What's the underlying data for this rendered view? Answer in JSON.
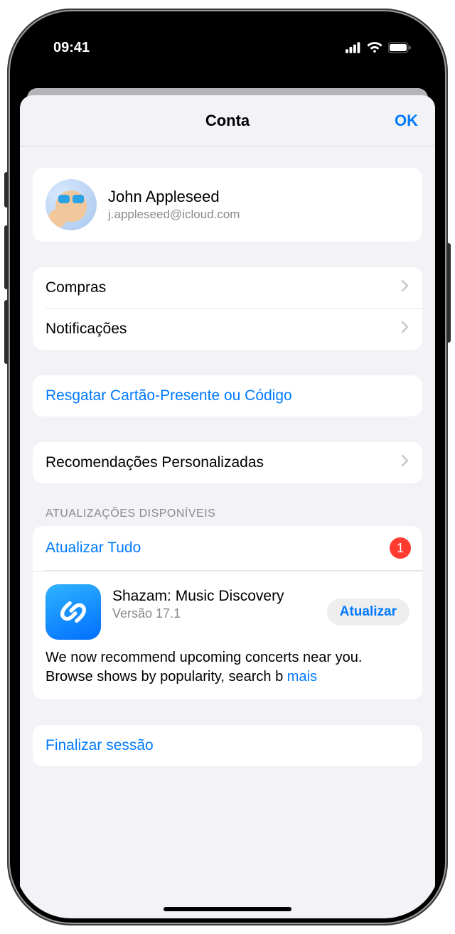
{
  "status": {
    "time": "09:41"
  },
  "header": {
    "title": "Conta",
    "ok": "OK"
  },
  "profile": {
    "name": "John Appleseed",
    "email": "j.appleseed@icloud.com"
  },
  "menu": {
    "purchases": "Compras",
    "notifications": "Notificações",
    "redeem": "Resgatar Cartão-Presente ou Código",
    "personalized": "Recomendações Personalizadas"
  },
  "updates": {
    "section_title": "ATUALIZAÇÕES DISPONÍVEIS",
    "update_all": "Atualizar Tudo",
    "badge": "1",
    "items": [
      {
        "name": "Shazam: Music Discovery",
        "version": "Versão 17.1",
        "button": "Atualizar",
        "notes_pre": "We now recommend upcoming concerts near you. Browse shows by popularity, search b",
        "more": "mais"
      }
    ]
  },
  "signout": "Finalizar sessão"
}
